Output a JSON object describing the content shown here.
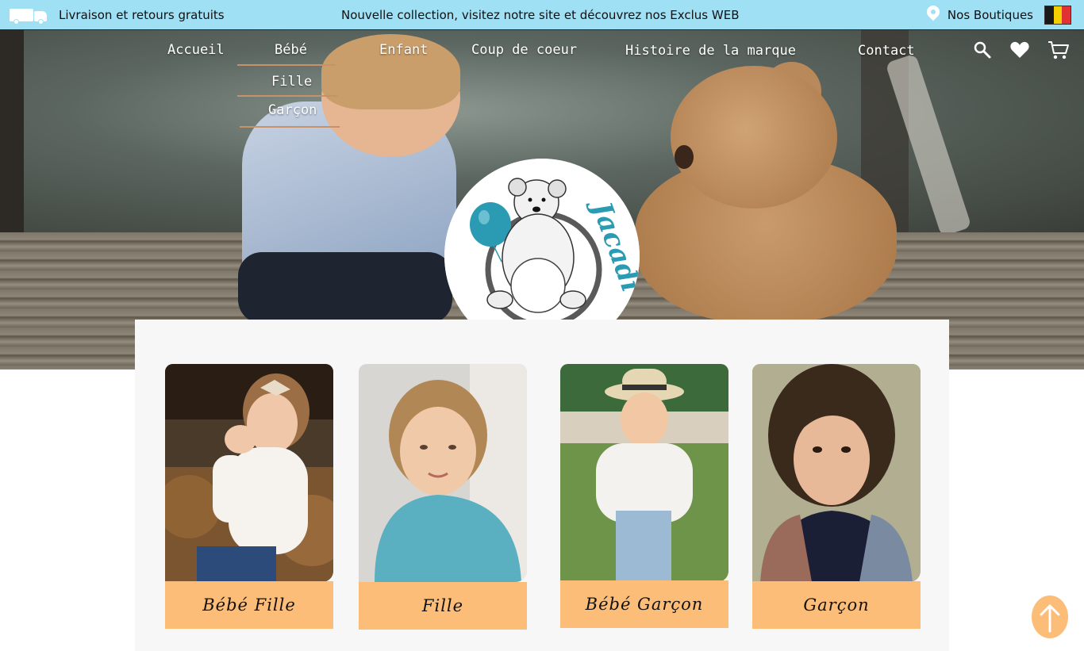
{
  "topbar": {
    "shipping_text": "Livraison et retours gratuits",
    "promo_text": "Nouvelle collection, visitez notre site et découvrez nos Exclus WEB",
    "stores_text": "Nos Boutiques"
  },
  "nav": {
    "items": [
      {
        "label": "Accueil"
      },
      {
        "label": "Bébé"
      },
      {
        "label": "Enfant"
      },
      {
        "label": "Coup de coeur"
      },
      {
        "label": "Histoire de la marque"
      },
      {
        "label": "Contact"
      }
    ],
    "bebe_submenu": [
      {
        "label": "Fille"
      },
      {
        "label": "Garçon"
      }
    ]
  },
  "logo": {
    "brand": "Jacadi"
  },
  "categories": [
    {
      "label": "Bébé Fille"
    },
    {
      "label": "Fille"
    },
    {
      "label": "Bébé Garçon"
    },
    {
      "label": "Garçon"
    }
  ],
  "icons": {
    "shipping": "truck-icon",
    "stores": "location-pin-icon",
    "country": "belgium-flag-icon",
    "search": "search-icon",
    "wishlist": "heart-icon",
    "cart": "cart-icon",
    "scroll_top": "arrow-up-icon"
  },
  "colors": {
    "topbar_bg": "#9fe0f4",
    "category_label_bg": "#fbbd78",
    "submenu_line": "#c7916a",
    "logo_accent": "#2a9bb3"
  }
}
